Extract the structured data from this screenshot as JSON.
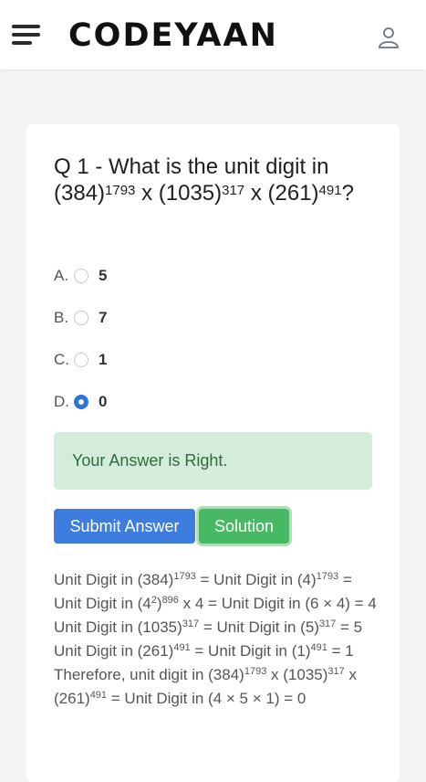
{
  "header": {
    "logo": "CODEYAAN",
    "menu_icon": "hamburger-icon",
    "user_icon": "user-icon"
  },
  "question": {
    "prefix": "Q 1 - What is the unit digit in ",
    "b1": "(384)",
    "e1": "1793",
    "sep1": " x ",
    "b2": "(1035)",
    "e2": "317",
    "sep2": " x ",
    "b3": "(261)",
    "e3": "491",
    "suffix": "?"
  },
  "options": [
    {
      "letter": "A.",
      "text": "5",
      "checked": false
    },
    {
      "letter": "B.",
      "text": "7",
      "checked": false
    },
    {
      "letter": "C.",
      "text": "1",
      "checked": false
    },
    {
      "letter": "D.",
      "text": "0",
      "checked": true
    }
  ],
  "alert": "Your Answer is Right.",
  "buttons": {
    "submit": "Submit Answer",
    "solution": "Solution"
  },
  "solution": {
    "t1": "Unit Digit in (384)",
    "s1": "1793",
    "t2": " = Unit Digit in (4)",
    "s2": "1793",
    "t3": " = Unit Digit in (4",
    "s3": "2",
    "t4": ")",
    "s4": "896",
    "t5": " x 4 = Unit Digit in (6 × 4) = 4 Unit Digit in (1035)",
    "s5": "317",
    "t6": " = Unit Digit in (5)",
    "s6": "317",
    "t7": " = 5 Unit Digit in (261)",
    "s7": "491",
    "t8": " = Unit Digit in (1)",
    "s8": "491",
    "t9": " = 1 Therefore, unit digit in (384)",
    "s9": "1793",
    "t10": " x (1035)",
    "s10": "317",
    "t11": " x (261)",
    "s11": "491",
    "t12": " = Unit Digit in (4 × 5 × 1) = 0"
  },
  "colors": {
    "primary": "#3d7ddf",
    "success": "#49b865",
    "alert_bg": "#d4edda",
    "alert_text": "#2f6b3e"
  }
}
